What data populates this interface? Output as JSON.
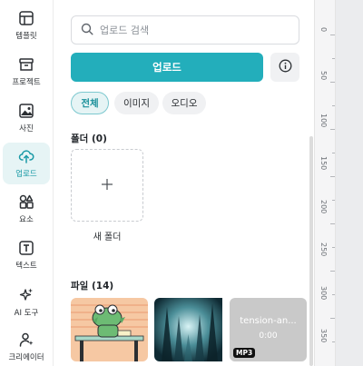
{
  "rail": {
    "items": [
      {
        "label": "템플릿",
        "icon": "template-icon"
      },
      {
        "label": "프로젝트",
        "icon": "project-icon"
      },
      {
        "label": "사진",
        "icon": "photo-icon"
      },
      {
        "label": "업로드",
        "icon": "upload-cloud-icon",
        "active": true
      },
      {
        "label": "요소",
        "icon": "elements-icon"
      },
      {
        "label": "텍스트",
        "icon": "text-icon"
      },
      {
        "label": "AI 도구",
        "icon": "ai-sparkle-icon"
      },
      {
        "label": "크리에이터",
        "icon": "creator-icon"
      }
    ]
  },
  "search": {
    "placeholder": "업로드 검색"
  },
  "upload_button": {
    "label": "업로드"
  },
  "filters": [
    {
      "label": "전체",
      "active": true
    },
    {
      "label": "이미지"
    },
    {
      "label": "오디오"
    }
  ],
  "folders": {
    "title": "폴더 (0)",
    "new_folder_label": "새 폴더"
  },
  "files": {
    "title": "파일 (14)",
    "items": [
      {
        "type": "image",
        "icon": "crocodile-illustration-thumbnail"
      },
      {
        "type": "image",
        "icon": "teal-forest-thumbnail"
      },
      {
        "type": "audio",
        "title": "tension-an...",
        "duration": "0:00",
        "badge": "MP3"
      }
    ]
  },
  "ruler": {
    "labels": [
      "0",
      "50",
      "100",
      "150",
      "200",
      "250",
      "300",
      "350"
    ]
  },
  "colors": {
    "accent": "#23aebb",
    "active_bg": "#e6f4f5"
  }
}
